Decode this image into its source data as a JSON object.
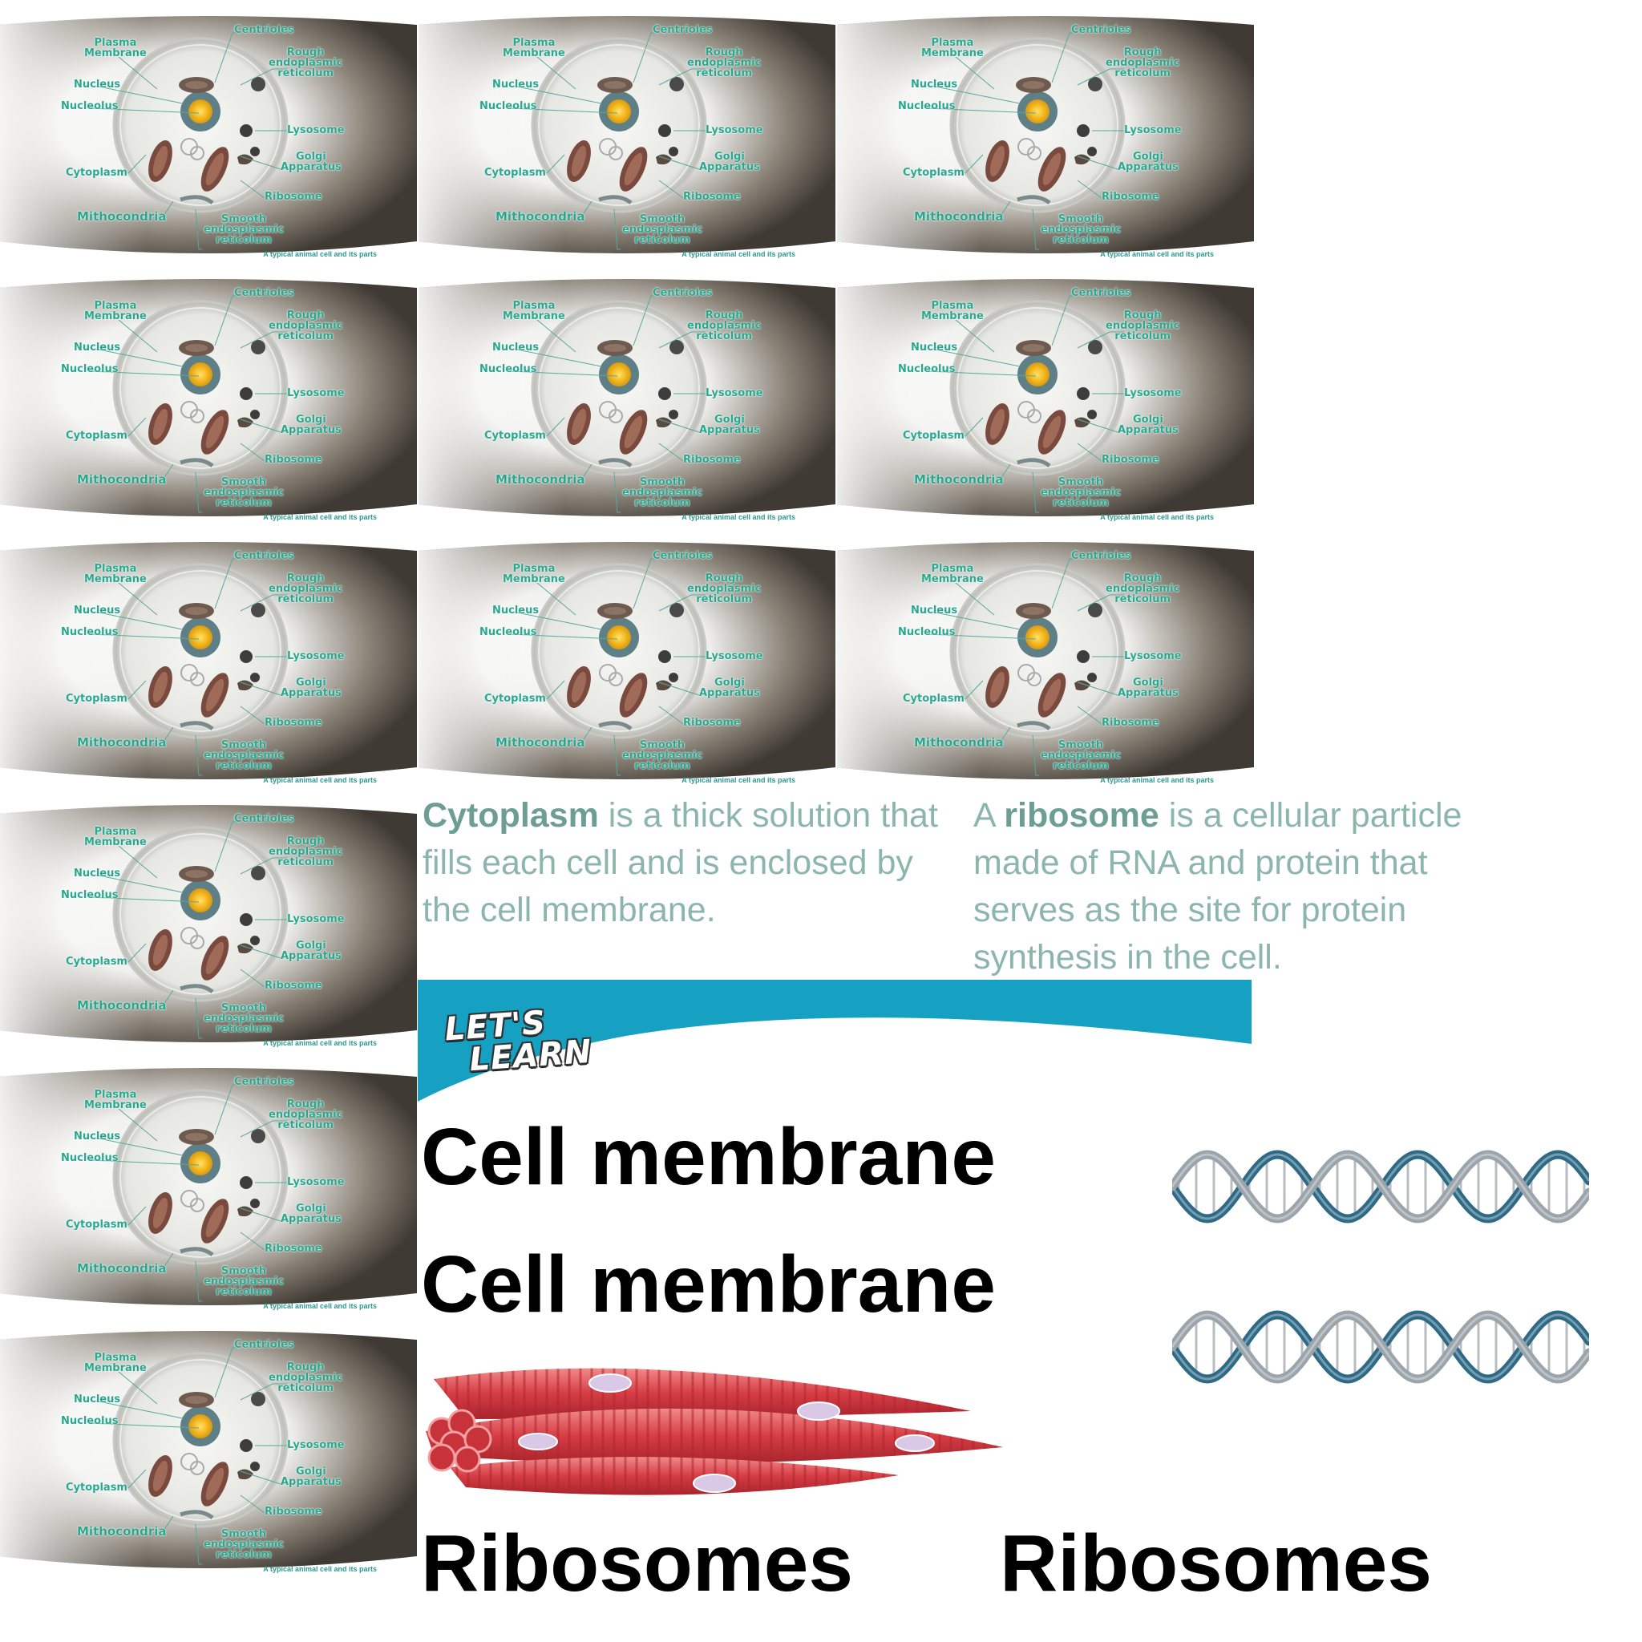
{
  "diagram": {
    "caption": "A typical animal cell and its parts",
    "labels": {
      "centrioles": "Centrioles",
      "plasma_membrane": "Plasma\nMembrane",
      "rough_er": "Rough\nendoplasmic\nreticolum",
      "nucleus": "Nucleus",
      "nucleolus": "Nucleolus",
      "lysosome": "Lysosome",
      "golgi": "Golgi\nApparatus",
      "cytoplasm": "Cytoplasm",
      "ribosome": "Ribosome",
      "mithocondria": "Mithocondria",
      "smooth_er": "Smooth\nendosplasmic\nreticolum"
    }
  },
  "definitions": {
    "cytoplasm": {
      "term": "Cytoplasm",
      "text": " is a thick solution that fills each cell and is enclosed by the cell membrane."
    },
    "ribosome": {
      "prefix": "A ",
      "term": "ribosome",
      "text": " is a cellular particle made of RNA and protein that serves as the site for protein synthesis in the cell."
    }
  },
  "banner": {
    "line1": "LET'S",
    "line2": "LEARN"
  },
  "headings": {
    "cell_membrane_1": "Cell membrane",
    "cell_membrane_2": "Cell membrane",
    "ribosomes_1": "Ribosomes",
    "ribosomes_2": "Ribosomes"
  },
  "colors": {
    "accent": "#2aa88f",
    "definition_text": "#8cb6ac",
    "banner": "#16a1c2"
  }
}
